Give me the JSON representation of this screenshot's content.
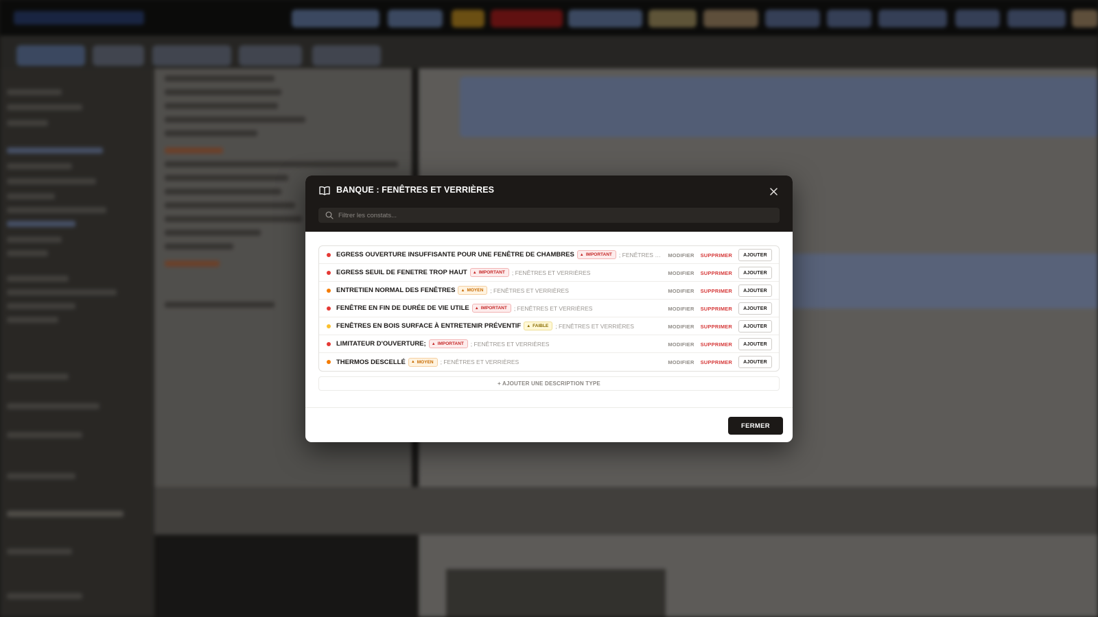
{
  "modal": {
    "title": "BANQUE : FENÊTRES ET VERRIÈRES",
    "search_placeholder": "Filtrer les constats...",
    "items": [
      {
        "title": "EGRESS OUVERTURE INSUFFISANTE POUR UNE FENÊTRE DE CHAMBRES",
        "severity": "IMPORTANT",
        "severity_key": "important",
        "dot_color": "#e53935",
        "category": "; FENÊTRES ET VERRIÈRES"
      },
      {
        "title": "EGRESS SEUIL DE FENETRE TROP HAUT",
        "severity": "IMPORTANT",
        "severity_key": "important",
        "dot_color": "#e53935",
        "category": "; FENÊTRES ET VERRIÈRES"
      },
      {
        "title": "ENTRETIEN NORMAL DES FENÊTRES",
        "severity": "MOYEN",
        "severity_key": "moyen",
        "dot_color": "#f57c00",
        "category": "; FENÊTRES ET VERRIÈRES"
      },
      {
        "title": "FENÊTRE EN FIN DE DURÉE DE VIE UTILE",
        "severity": "IMPORTANT",
        "severity_key": "important",
        "dot_color": "#e53935",
        "category": "; FENÊTRES ET VERRIÈRES"
      },
      {
        "title": "FENÊTRES EN BOIS SURFACE À ENTRETENIR PRÉVENTIF",
        "severity": "FAIBLE",
        "severity_key": "faible",
        "dot_color": "#fbc02d",
        "category": "; FENÊTRES ET VERRIÈRES"
      },
      {
        "title": "LIMITATEUR D'OUVERTURE;",
        "severity": "IMPORTANT",
        "severity_key": "important",
        "dot_color": "#e53935",
        "category": "; FENÊTRES ET VERRIÈRES"
      },
      {
        "title": "THERMOS DESCELLÉ",
        "severity": "MOYEN",
        "severity_key": "moyen",
        "dot_color": "#f57c00",
        "category": "; FENÊTRES ET VERRIÈRES"
      }
    ],
    "actions": {
      "modify": "MODIFIER",
      "delete": "SUPPRIMER",
      "add": "AJOUTER"
    },
    "add_type_label": "+ AJOUTER UNE DESCRIPTION TYPE",
    "close_label": "FERMER",
    "icons": {
      "header": "book-icon",
      "close": "close-icon",
      "search": "search-icon",
      "severity": "warning-icon"
    }
  }
}
